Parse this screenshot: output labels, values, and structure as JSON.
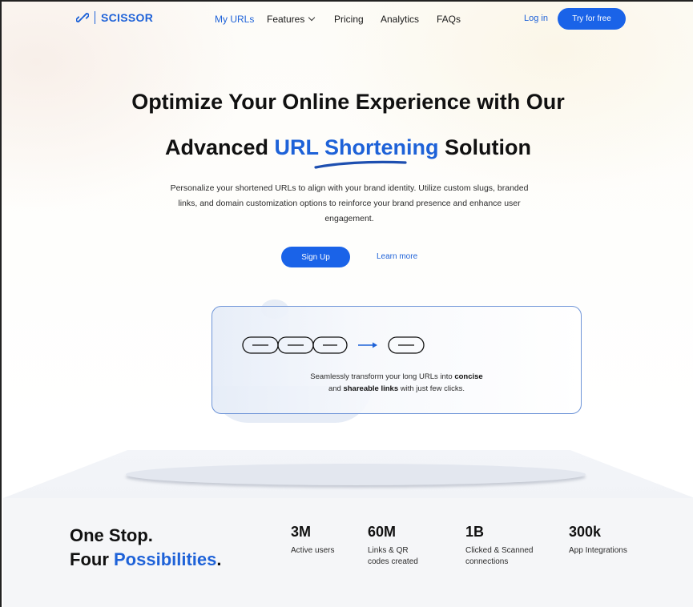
{
  "brand": {
    "name": "SCISSOR",
    "icon": "scissor-link-icon",
    "color": "#1e62d8"
  },
  "nav": {
    "links": [
      "My URLs",
      "Features",
      "Pricing",
      "Analytics",
      "FAQs"
    ],
    "active": "My URLs",
    "login_label": "Log in",
    "cta_label": "Try for free"
  },
  "hero": {
    "title_line1": "Optimize Your Online Experience with Our",
    "title_line2_pre": "Advanced ",
    "title_line2_accent": "URL Shortening",
    "title_line2_post": " Solution",
    "description": "Personalize your shortened URLs to align with your brand identity. Utilize custom slugs, branded links, and domain customization options to reinforce your brand presence and enhance user engagement.",
    "primary_button": "Sign Up",
    "secondary_link": "Learn more"
  },
  "card": {
    "text_1": "Seamlessly transform your long URLs into ",
    "bold_1": "concise",
    "text_2": "and ",
    "bold_2": "shareable links",
    "text_3": " with just few clicks.",
    "icons": [
      "long-chain-icon",
      "arrow-right-icon",
      "short-link-icon"
    ]
  },
  "stats": {
    "tagline_line1": "One Stop.",
    "tagline_line2_pre": "Four ",
    "tagline_line2_accent": "Possibilities",
    "tagline_line2_post": ".",
    "items": [
      {
        "value": "3M",
        "label_1": "Active users",
        "label_2": ""
      },
      {
        "value": "60M",
        "label_1": "Links & QR",
        "label_2": "codes created"
      },
      {
        "value": "1B",
        "label_1": "Clicked & Scanned",
        "label_2": "connections"
      },
      {
        "value": "300k",
        "label_1": "App Integrations",
        "label_2": ""
      }
    ]
  },
  "colors": {
    "accent": "#1a63e8",
    "text": "#111111",
    "stats_bg": "#f5f6f8"
  }
}
